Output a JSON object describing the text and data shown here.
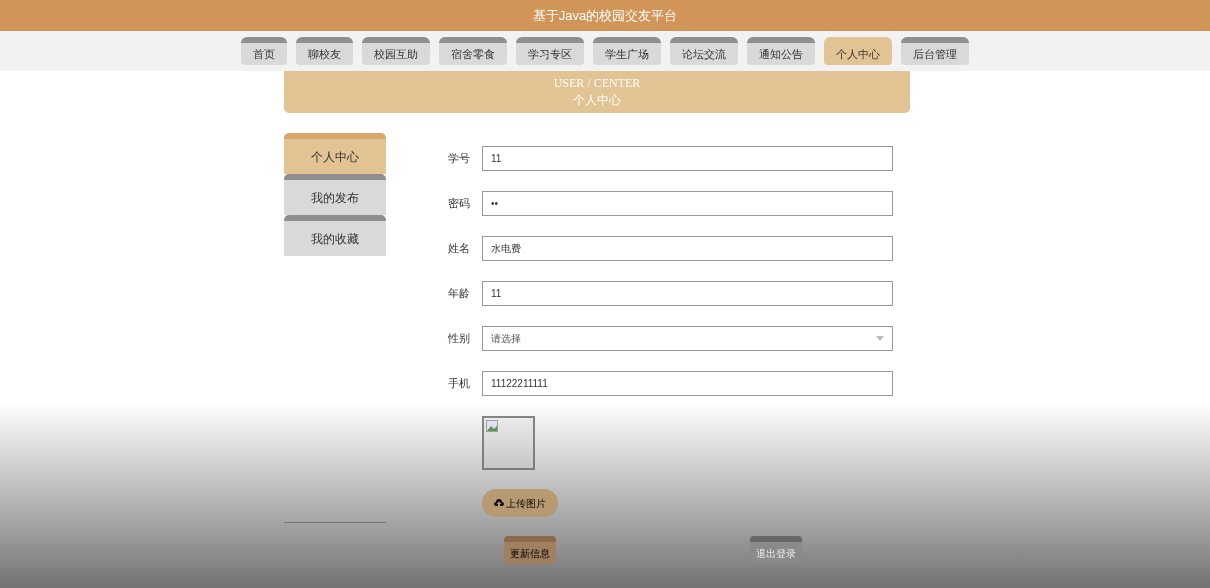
{
  "header": {
    "title": "基于Java的校园交友平台"
  },
  "nav": [
    {
      "label": "首页",
      "selected": false
    },
    {
      "label": "聊校友",
      "selected": false
    },
    {
      "label": "校园互助",
      "selected": false
    },
    {
      "label": "宿舍零食",
      "selected": false
    },
    {
      "label": "学习专区",
      "selected": false
    },
    {
      "label": "学生广场",
      "selected": false
    },
    {
      "label": "论坛交流",
      "selected": false
    },
    {
      "label": "通知公告",
      "selected": false
    },
    {
      "label": "个人中心",
      "selected": true
    },
    {
      "label": "后台管理",
      "selected": false
    }
  ],
  "banner": {
    "subtitle": "USER / CENTER",
    "title": "个人中心"
  },
  "sidebar": [
    {
      "label": "个人中心",
      "selected": true
    },
    {
      "label": "我的发布",
      "selected": false
    },
    {
      "label": "我的收藏",
      "selected": false
    }
  ],
  "form": [
    {
      "label": "学号",
      "kind": "text",
      "value": "11"
    },
    {
      "label": "密码",
      "kind": "text",
      "value": "••"
    },
    {
      "label": "姓名",
      "kind": "text",
      "value": "水电费"
    },
    {
      "label": "年龄",
      "kind": "text",
      "value": "11"
    },
    {
      "label": "性别",
      "kind": "select",
      "value": "请选择"
    },
    {
      "label": "手机",
      "kind": "text",
      "value": "11122211111"
    }
  ],
  "upload_button": "上传图片",
  "buttons": [
    {
      "label": "更新信息",
      "kind": "primary"
    },
    {
      "label": "退出登录",
      "kind": "secondary"
    }
  ]
}
